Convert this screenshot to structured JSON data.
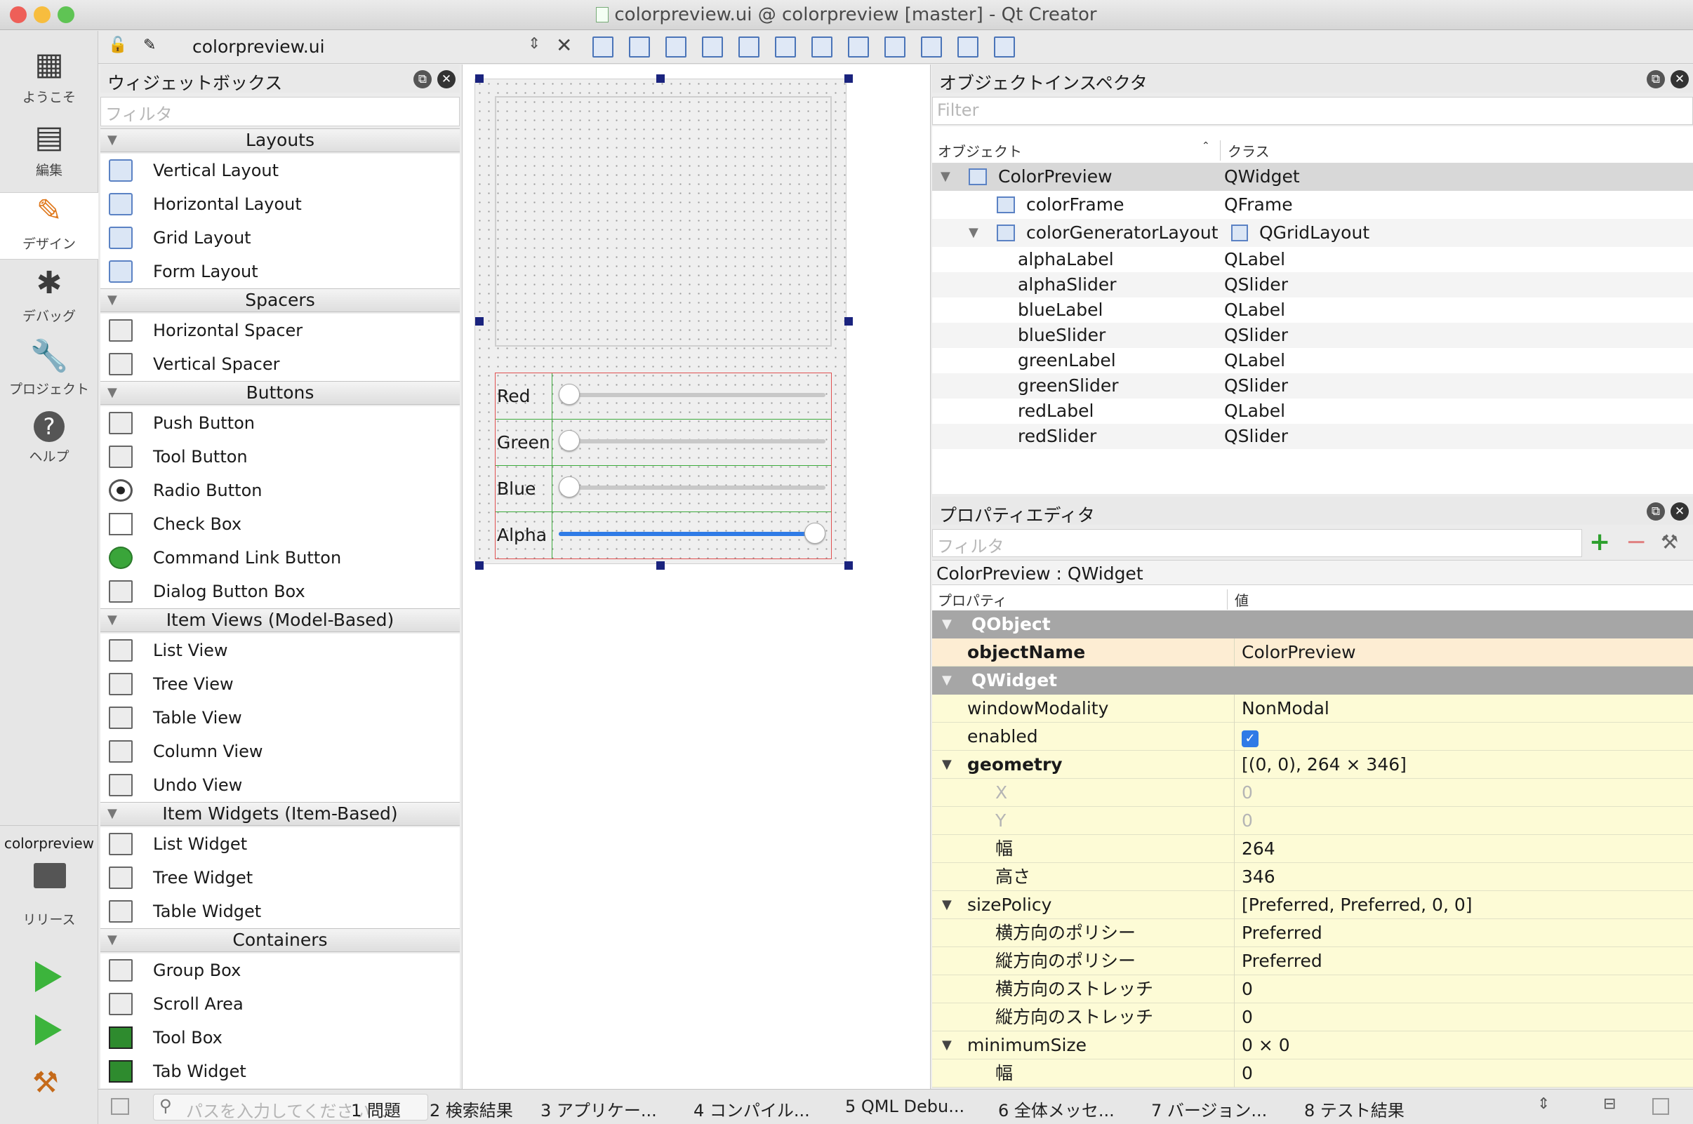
{
  "window": {
    "title": "colorpreview.ui @ colorpreview [master] - Qt Creator"
  },
  "toolbar": {
    "file_name": "colorpreview.ui"
  },
  "modes": [
    {
      "label": "ようこそ",
      "icon": "grid-icon"
    },
    {
      "label": "編集",
      "icon": "edit-doc-icon"
    },
    {
      "label": "デザイン",
      "icon": "pencil-icon"
    },
    {
      "label": "デバッグ",
      "icon": "bug-icon"
    },
    {
      "label": "プロジェクト",
      "icon": "wrench-icon"
    },
    {
      "label": "ヘルプ",
      "icon": "help-icon"
    }
  ],
  "kit": {
    "project": "colorpreview",
    "build": "リリース"
  },
  "widgetbox": {
    "title": "ウィジェットボックス",
    "filter_placeholder": "フィルタ",
    "categories": [
      {
        "name": "Layouts",
        "items": [
          "Vertical Layout",
          "Horizontal Layout",
          "Grid Layout",
          "Form Layout"
        ]
      },
      {
        "name": "Spacers",
        "items": [
          "Horizontal Spacer",
          "Vertical Spacer"
        ]
      },
      {
        "name": "Buttons",
        "items": [
          "Push Button",
          "Tool Button",
          "Radio Button",
          "Check Box",
          "Command Link Button",
          "Dialog Button Box"
        ]
      },
      {
        "name": "Item Views (Model-Based)",
        "items": [
          "List View",
          "Tree View",
          "Table View",
          "Column View",
          "Undo View"
        ]
      },
      {
        "name": "Item Widgets (Item-Based)",
        "items": [
          "List Widget",
          "Tree Widget",
          "Table Widget"
        ]
      },
      {
        "name": "Containers",
        "items": [
          "Group Box",
          "Scroll Area",
          "Tool Box",
          "Tab Widget"
        ]
      }
    ]
  },
  "form": {
    "sliders": [
      {
        "label": "Red",
        "value": 0
      },
      {
        "label": "Green",
        "value": 0
      },
      {
        "label": "Blue",
        "value": 0
      },
      {
        "label": "Alpha",
        "value": 1.0
      }
    ]
  },
  "inspector": {
    "title": "オブジェクトインスペクタ",
    "filter_placeholder": "Filter",
    "col_object": "オブジェクト",
    "col_class": "クラス",
    "rows": [
      {
        "object": "ColorPreview",
        "class": "QWidget"
      },
      {
        "object": "colorFrame",
        "class": "QFrame"
      },
      {
        "object": "colorGeneratorLayout",
        "class": "QGridLayout"
      },
      {
        "object": "alphaLabel",
        "class": "QLabel"
      },
      {
        "object": "alphaSlider",
        "class": "QSlider"
      },
      {
        "object": "blueLabel",
        "class": "QLabel"
      },
      {
        "object": "blueSlider",
        "class": "QSlider"
      },
      {
        "object": "greenLabel",
        "class": "QLabel"
      },
      {
        "object": "greenSlider",
        "class": "QSlider"
      },
      {
        "object": "redLabel",
        "class": "QLabel"
      },
      {
        "object": "redSlider",
        "class": "QSlider"
      }
    ]
  },
  "properties": {
    "title": "プロパティエディタ",
    "filter_placeholder": "フィルタ",
    "context": "ColorPreview : QWidget",
    "col_prop": "プロパティ",
    "col_value": "値",
    "rows": [
      {
        "name": "QObject",
        "value": "",
        "kind": "group"
      },
      {
        "name": "objectName",
        "value": "ColorPreview",
        "kind": "bold"
      },
      {
        "name": "QWidget",
        "value": "",
        "kind": "group"
      },
      {
        "name": "windowModality",
        "value": "NonModal",
        "kind": "normal"
      },
      {
        "name": "enabled",
        "value": "",
        "kind": "check"
      },
      {
        "name": "geometry",
        "value": "[(0, 0), 264 × 346]",
        "kind": "boldexp"
      },
      {
        "name": "X",
        "value": "0",
        "kind": "dim"
      },
      {
        "name": "Y",
        "value": "0",
        "kind": "dim"
      },
      {
        "name": "幅",
        "value": "264",
        "kind": "sub"
      },
      {
        "name": "高さ",
        "value": "346",
        "kind": "sub"
      },
      {
        "name": "sizePolicy",
        "value": "[Preferred, Preferred, 0, 0]",
        "kind": "exp"
      },
      {
        "name": "横方向のポリシー",
        "value": "Preferred",
        "kind": "sub"
      },
      {
        "name": "縦方向のポリシー",
        "value": "Preferred",
        "kind": "sub"
      },
      {
        "name": "横方向のストレッチ",
        "value": "0",
        "kind": "sub"
      },
      {
        "name": "縦方向のストレッチ",
        "value": "0",
        "kind": "sub"
      },
      {
        "name": "minimumSize",
        "value": "0 × 0",
        "kind": "exp"
      },
      {
        "name": "幅",
        "value": "0",
        "kind": "sub"
      }
    ]
  },
  "statusbar": {
    "locator_placeholder": "パスを入力してください ...",
    "tabs": [
      "1 問題",
      "2 検索結果",
      "3 アプリケー...",
      "4 コンパイル...",
      "5 QML Debu...",
      "6 全体メッセ...",
      "7 バージョン...",
      "8 テスト結果"
    ]
  }
}
